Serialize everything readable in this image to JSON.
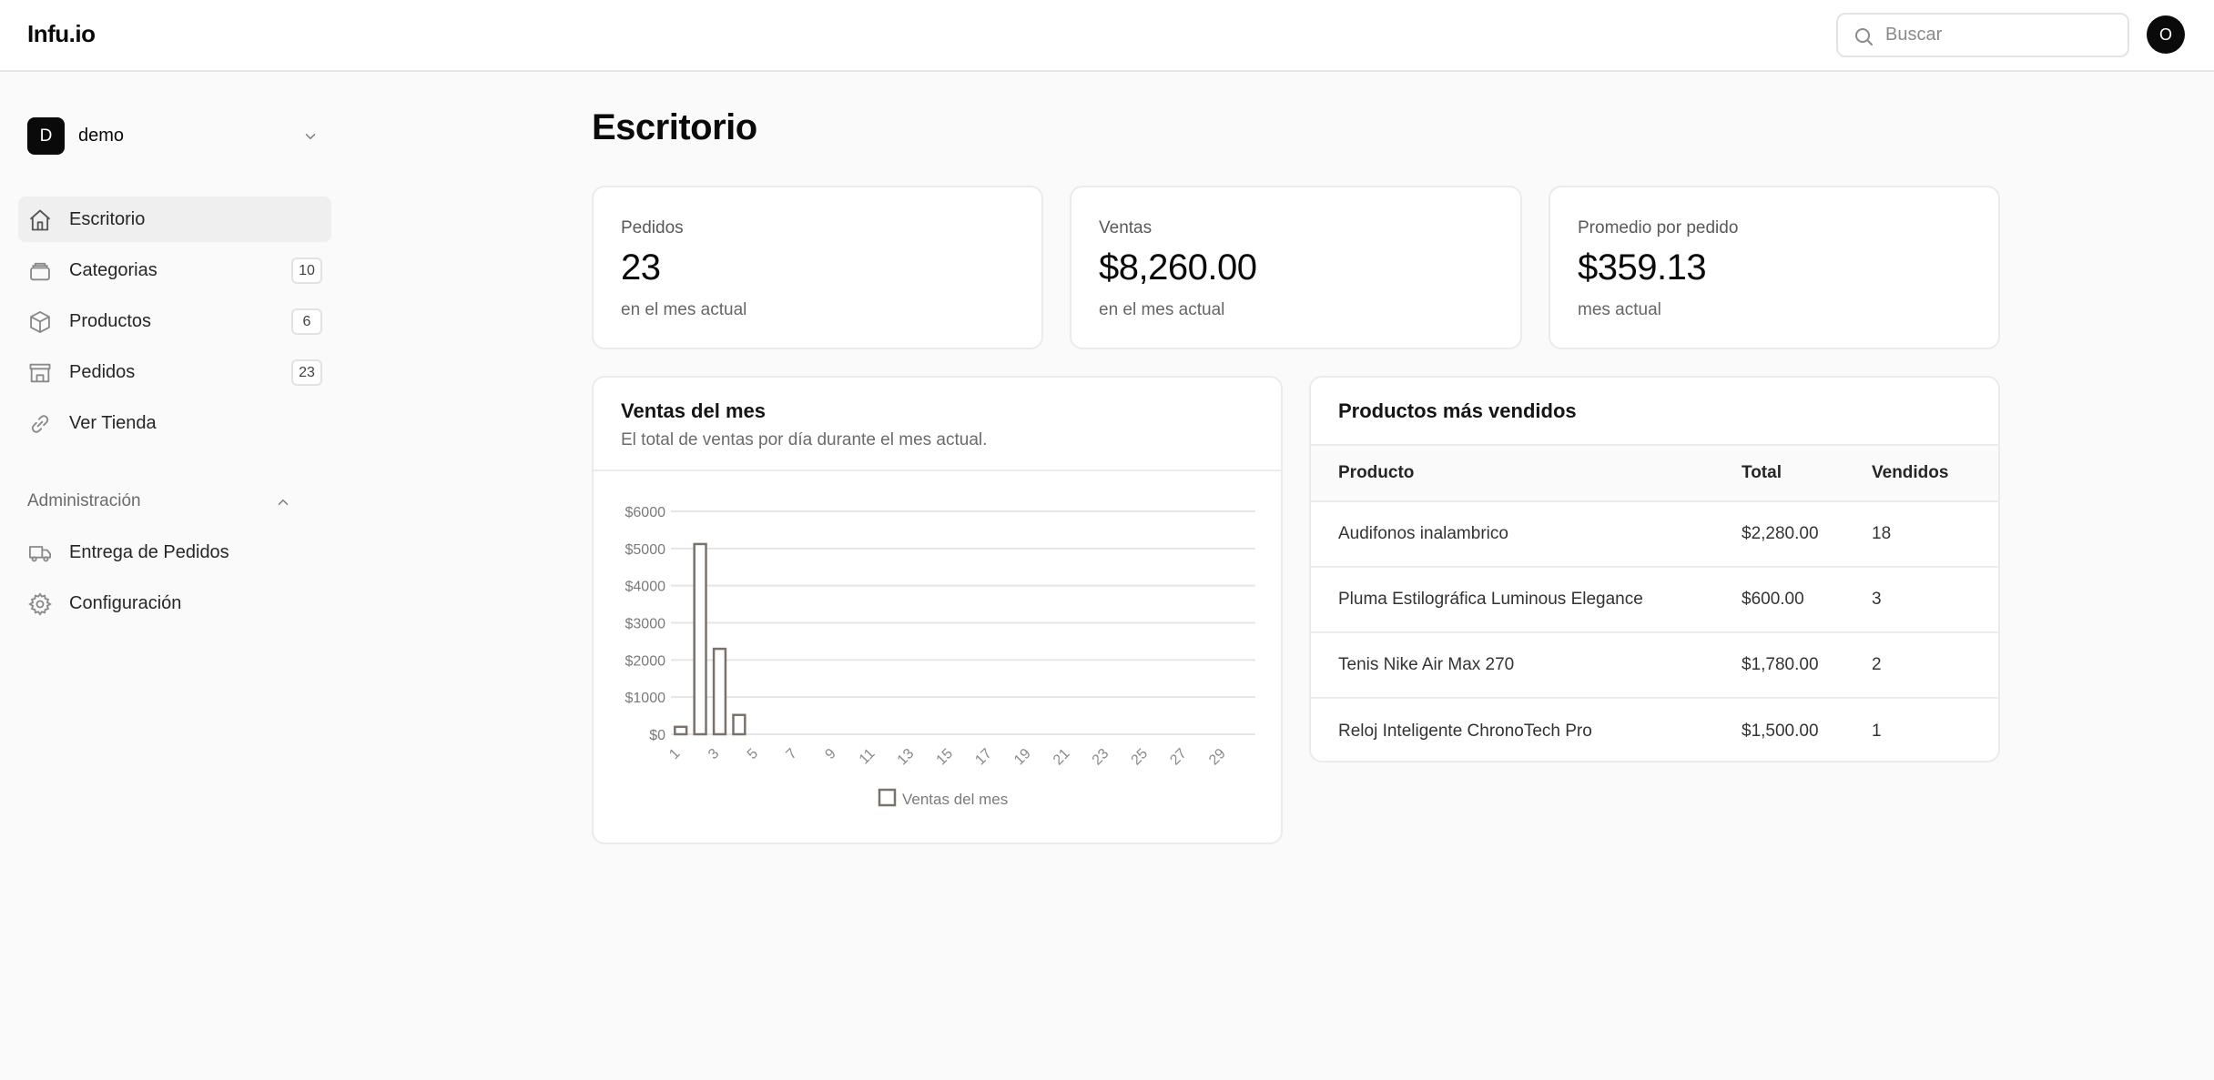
{
  "header": {
    "logo": "Infu.io",
    "search_placeholder": "Buscar",
    "avatar_initial": "O"
  },
  "sidebar": {
    "org": {
      "initial": "D",
      "name": "demo"
    },
    "items": [
      {
        "label": "Escritorio",
        "icon": "home-icon",
        "count": null,
        "active": true
      },
      {
        "label": "Categorias",
        "icon": "layers-icon",
        "count": "10"
      },
      {
        "label": "Productos",
        "icon": "box-icon",
        "count": "6"
      },
      {
        "label": "Pedidos",
        "icon": "store-icon",
        "count": "23"
      },
      {
        "label": "Ver Tienda",
        "icon": "link-icon",
        "count": null
      }
    ],
    "section": {
      "title": "Administración",
      "items": [
        {
          "label": "Entrega de Pedidos",
          "icon": "truck-icon"
        },
        {
          "label": "Configuración",
          "icon": "gear-icon"
        }
      ]
    }
  },
  "main": {
    "title": "Escritorio",
    "stats": [
      {
        "label": "Pedidos",
        "value": "23",
        "sub": "en el mes actual"
      },
      {
        "label": "Ventas",
        "value": "$8,260.00",
        "sub": "en el mes actual"
      },
      {
        "label": "Promedio por pedido",
        "value": "$359.13",
        "sub": "mes actual"
      }
    ],
    "sales_card": {
      "title": "Ventas del mes",
      "description": "El total de ventas por día durante el mes actual."
    },
    "top_products": {
      "title": "Productos más vendidos",
      "columns": [
        "Producto",
        "Total",
        "Vendidos"
      ],
      "rows": [
        [
          "Audifonos inalambrico",
          "$2,280.00",
          "18"
        ],
        [
          "Pluma Estilográfica Luminous Elegance",
          "$600.00",
          "3"
        ],
        [
          "Tenis Nike Air Max 270",
          "$1,780.00",
          "2"
        ],
        [
          "Reloj Inteligente ChronoTech Pro",
          "$1,500.00",
          "1"
        ]
      ]
    }
  },
  "chart_data": {
    "type": "bar",
    "x": [
      1,
      2,
      3,
      4,
      5,
      6,
      7,
      8,
      9,
      10,
      11,
      12,
      13,
      14,
      15,
      16,
      17,
      18,
      19,
      20,
      21,
      22,
      23,
      24,
      25,
      26,
      27,
      28,
      29,
      30
    ],
    "x_tick_labels": [
      "1",
      "3",
      "5",
      "7",
      "9",
      "11",
      "13",
      "15",
      "17",
      "19",
      "21",
      "23",
      "25",
      "27",
      "29"
    ],
    "series": [
      {
        "name": "Ventas del mes",
        "values": [
          200,
          5120,
          2300,
          520,
          0,
          0,
          0,
          0,
          0,
          0,
          0,
          0,
          0,
          0,
          0,
          0,
          0,
          0,
          0,
          0,
          0,
          0,
          0,
          0,
          0,
          0,
          0,
          0,
          0,
          0
        ]
      }
    ],
    "y_tick_labels": [
      "$0",
      "$1000",
      "$2000",
      "$3000",
      "$4000",
      "$5000",
      "$6000"
    ],
    "ylim": [
      0,
      6000
    ],
    "grid": true,
    "legend": "bottom-center",
    "colors": {
      "bar_fill": "#ffffff",
      "bar_stroke": "#7a736c",
      "grid": "#e5e5e5"
    }
  }
}
